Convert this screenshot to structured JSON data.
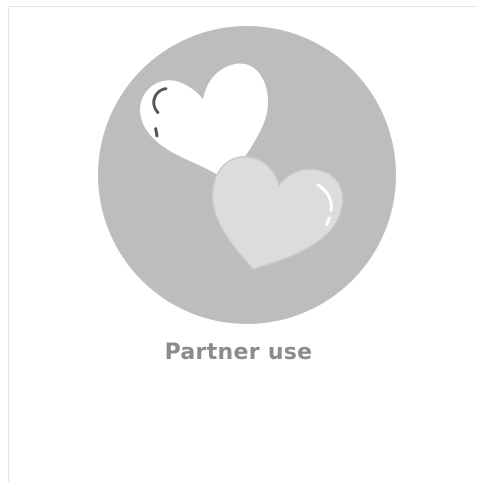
{
  "tile": {
    "label": "Partner use",
    "icon": "two-hearts-icon"
  },
  "colors": {
    "circle": "#bdbdbd",
    "heart_back": "#ffffff",
    "heart_front": "#dcdcdc",
    "label_text": "#8c8c8c"
  }
}
